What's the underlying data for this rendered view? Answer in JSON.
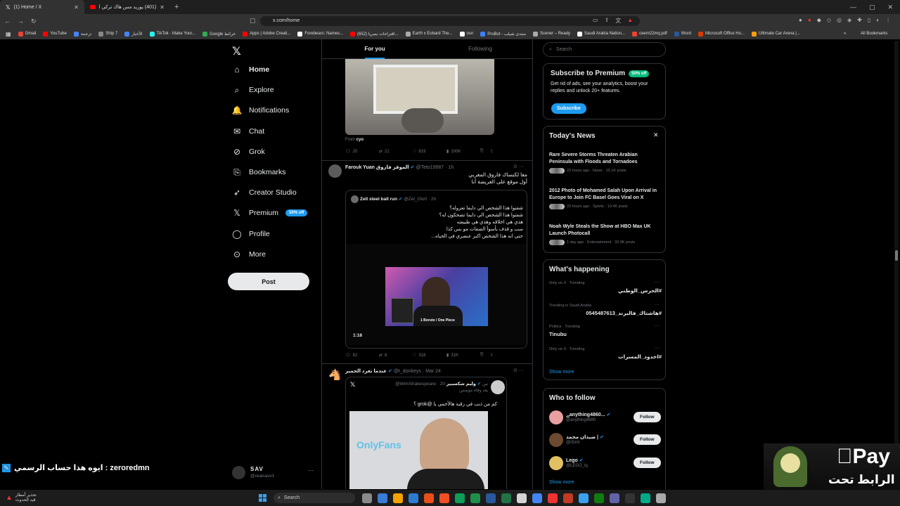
{
  "browser": {
    "tabs": [
      {
        "label": "(1) Home / X",
        "icon": "x-logo-icon"
      },
      {
        "label": "(401) يوريد مس هاك تركي اليمنيش",
        "icon": "youtube-icon"
      }
    ],
    "url": "x.com/home",
    "bookmarks": [
      {
        "label": "Gmail",
        "color": "#ea4335"
      },
      {
        "label": "YouTube",
        "color": "#ff0000"
      },
      {
        "label": "ترجمة",
        "color": "#4285f4"
      },
      {
        "label": "Ship 7",
        "color": "#888888"
      },
      {
        "label": "الأخبار",
        "color": "#4285f4"
      },
      {
        "label": "TikTok - Make Your...",
        "color": "#25f4ee"
      },
      {
        "label": "Google خرائط",
        "color": "#34a853"
      },
      {
        "label": "Apps | Adobe Creati...",
        "color": "#ff0000"
      },
      {
        "label": "Forebears: Names...",
        "color": "#ffffff"
      },
      {
        "label": "(652) اقتراحات بصريا...",
        "color": "#ff0000"
      },
      {
        "label": "Earth x Eobard The...",
        "color": "#aaaaaa"
      },
      {
        "label": "osn",
        "color": "#ffffff"
      },
      {
        "label": "ProBot - منتدى شيلب",
        "color": "#3b82f6"
      },
      {
        "label": "Scener – Ready",
        "color": "#aaaaaa"
      },
      {
        "label": "Saudi Arabia Nation...",
        "color": "#ffffff"
      },
      {
        "label": "ceem22mq.pdf",
        "color": "#ea4335"
      },
      {
        "label": "Word",
        "color": "#2b579a"
      },
      {
        "label": "Microsoft Office Ho...",
        "color": "#d83b01"
      },
      {
        "label": "Ultimate Car Arena |...",
        "color": "#f59e0b"
      }
    ],
    "all_bookmarks": "All Bookmarks"
  },
  "sidebar": {
    "items": [
      {
        "label": "Home",
        "icon": "home-icon"
      },
      {
        "label": "Explore",
        "icon": "search-icon"
      },
      {
        "label": "Notifications",
        "icon": "bell-icon"
      },
      {
        "label": "Chat",
        "icon": "mail-icon"
      },
      {
        "label": "Grok",
        "icon": "grok-icon"
      },
      {
        "label": "Bookmarks",
        "icon": "bookmark-icon"
      },
      {
        "label": "Creator Studio",
        "icon": "rocket-icon"
      },
      {
        "label": "Premium",
        "icon": "x-logo-icon",
        "badge": "50% off"
      },
      {
        "label": "Profile",
        "icon": "person-icon"
      },
      {
        "label": "More",
        "icon": "more-circle-icon"
      }
    ],
    "post_label": "Post",
    "account": {
      "name": "SAV",
      "handle": "@realsavv1"
    }
  },
  "feed": {
    "tabs": [
      "For you",
      "Following"
    ],
    "tweet0": {
      "from_label": "From",
      "from_name": "cyo",
      "replies": "20",
      "reposts": "21",
      "likes": "819",
      "views": "100K"
    },
    "tweet1": {
      "name": "Farouk Yuan الموقر فاروق",
      "handle": "@Teto19987 · 1h",
      "text": [
        "معا لكنساك فاروق المغربي",
        "أول موقع على العريضة أنا"
      ],
      "quote": {
        "name": "Zell steel ball run",
        "handle": "@Zel_Olo0 · 2h",
        "text": [
          "شفتوا هذا الشخص الي دايما تعزوله؟",
          "شفتوا هذا الشخص الي دايما تضحكون له؟",
          "هذي هي اخلاقه وهذي هي طبيعته",
          "سب و قذف بأسوأ الصفات مو بس كذا",
          "حتى انه هذا الشخص اكبر عنصري في الحياه..."
        ],
        "video_duration": "1:18",
        "video_caption": "1 Boruto / One Piece"
      },
      "replies": "62",
      "reposts": "8",
      "likes": "318",
      "views": "31K"
    },
    "tweet2": {
      "name": "عندما تغرد الحمير",
      "handle": "@t_donkeys · Mar 24",
      "inner_name": "وليم شكسبير",
      "inner_handle": "@WimShakespeare · 20 س",
      "inner_line": "يعد وفاة مؤسس",
      "inner_text": "كم من ذنب في رقبة هالأخمي يا @grok ؟",
      "image_text": "OnlyFans"
    }
  },
  "right": {
    "search_placeholder": "Search",
    "premium": {
      "title": "Subscribe to Premium",
      "badge": "50% off",
      "text": "Get rid of ads, see your analytics, boost your replies and unlock 20+ features.",
      "button": "Subscribe"
    },
    "news": {
      "title": "Today's News",
      "items": [
        {
          "title": "Rare Severe Storms Threaten Arabian Peninsula with Floods and Tornadoes",
          "meta": "23 hours ago · News · 15.1K posts"
        },
        {
          "title": "2012 Photo of Mohamed Salah Upon Arrival in Europe to Join FC Basel Goes Viral on X",
          "meta": "23 hours ago · Sports · 10.4K posts"
        },
        {
          "title": "Noah Wyle Steals the Show at HBO Max UK Launch Photocall",
          "meta": "1 day ago · Entertainment · 33.9K posts"
        }
      ]
    },
    "happening": {
      "title": "What's happening",
      "items": [
        {
          "meta": "Only on X · Trending",
          "name": "#الحرس_الوطني"
        },
        {
          "meta": "Trending in Saudi Arabia",
          "name": "#هاشتاك_فالبرند_0545487613"
        },
        {
          "meta": "Politics · Trending",
          "name": "Tinubu"
        },
        {
          "meta": "Only on X · Trending",
          "name": "#اخدود_المسرات"
        }
      ],
      "show_more": "Show more"
    },
    "follow": {
      "title": "Who to follow",
      "items": [
        {
          "name": "ﮯanything4860...",
          "handle": "@anything4680",
          "color": "#e8a0a0"
        },
        {
          "name": "ضيدان محمد |",
          "handle": "@iSimt",
          "color": "#6b4a2f"
        },
        {
          "name": "Lego",
          "handle": "@LEGO_lq",
          "color": "#e0c060"
        }
      ],
      "button": "Follow",
      "show_more": "Show more"
    }
  },
  "overlay": {
    "stream_text": "ايوه هذا حساب الرسمي : zeroredmn",
    "brand_text": "Pay",
    "corner_text": "الرابط تحت"
  },
  "taskbar": {
    "search_label": "Search",
    "notice": [
      "تحذير أمطار",
      "قيد الحدوث"
    ]
  }
}
